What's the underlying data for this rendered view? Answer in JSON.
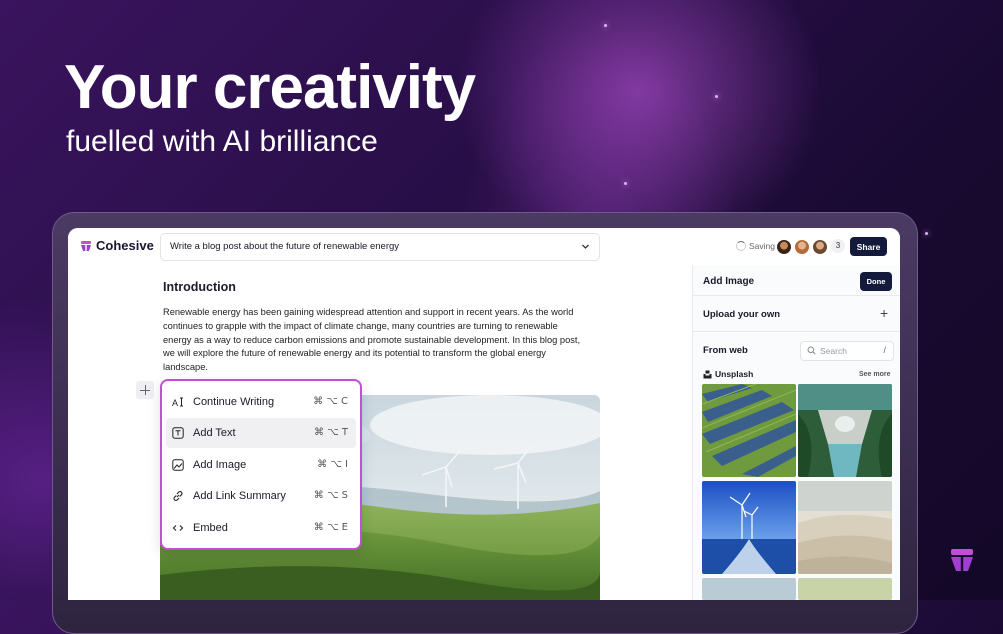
{
  "hero": {
    "title": "Your creativity",
    "subtitle": "fuelled with AI brilliance"
  },
  "app": {
    "name": "Cohesive",
    "prompt": "Write a blog post about the future of renewable energy",
    "saving_label": "Saving",
    "collaborator_count": "3",
    "share_label": "Share"
  },
  "editor": {
    "heading": "Introduction",
    "paragraph": "Renewable energy has been gaining widespread attention and support in recent years. As the world continues to grapple with the impact of climate change, many countries are turning to renewable energy as a way to reduce carbon emissions and promote sustainable development. In this blog post, we will explore the future of renewable energy and its potential to transform the global energy landscape."
  },
  "menu": {
    "items": [
      {
        "label": "Continue Writing",
        "shortcut": "⌘ ⌥ C",
        "icon": "ai-text-icon"
      },
      {
        "label": "Add Text",
        "shortcut": "⌘ ⌥ T",
        "icon": "text-icon",
        "active": true
      },
      {
        "label": "Add Image",
        "shortcut": "⌘ ⌥ I",
        "icon": "image-icon"
      },
      {
        "label": "Add Link Summary",
        "shortcut": "⌘ ⌥ S",
        "icon": "link-icon"
      },
      {
        "label": "Embed",
        "shortcut": "⌘ ⌥ E",
        "icon": "code-icon"
      }
    ]
  },
  "panel": {
    "title": "Add Image",
    "done_label": "Done",
    "upload_label": "Upload your own",
    "web_label": "From web",
    "search_placeholder": "Search",
    "search_shortcut": "/",
    "source_label": "Unsplash",
    "see_more": "See more"
  },
  "colors": {
    "accent": "#c24fd1",
    "primary_button": "#141a3c"
  }
}
